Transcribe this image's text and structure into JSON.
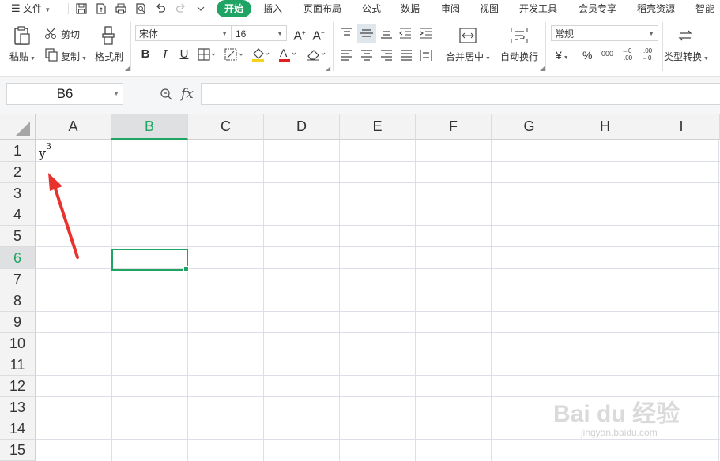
{
  "menu": {
    "file_label": "文件",
    "tabs": [
      "开始",
      "插入",
      "页面布局",
      "公式",
      "数据",
      "审阅",
      "视图",
      "开发工具",
      "会员专享",
      "稻壳资源",
      "智能"
    ]
  },
  "ribbon": {
    "paste_label": "粘贴",
    "cut_label": "剪切",
    "copy_label": "复制",
    "format_painter_label": "格式刷",
    "font_name": "宋体",
    "font_size": "16",
    "merge_center_label": "合并居中",
    "wrap_text_label": "自动换行",
    "number_format": "常规",
    "type_convert_label": "类型转换",
    "currency_symbol": "¥",
    "percent_symbol": "%",
    "thousands_symbol": "000"
  },
  "formula_bar": {
    "name_box": "B6",
    "fx_label": "fx",
    "formula": ""
  },
  "sheet": {
    "columns": [
      "A",
      "B",
      "C",
      "D",
      "E",
      "F",
      "G",
      "H",
      "I"
    ],
    "rows": [
      "1",
      "2",
      "3",
      "4",
      "5",
      "6",
      "7",
      "8",
      "9",
      "10",
      "11",
      "12",
      "13",
      "14",
      "15"
    ],
    "selected_column": "B",
    "selected_row": "6",
    "cell_A1_base": "y",
    "cell_A1_superscript": "3"
  },
  "watermark": {
    "brand": "Bai du 经验",
    "url": "jingyan.baidu.com"
  },
  "colors": {
    "accent": "#1fa463",
    "arrow": "#e8322d"
  }
}
